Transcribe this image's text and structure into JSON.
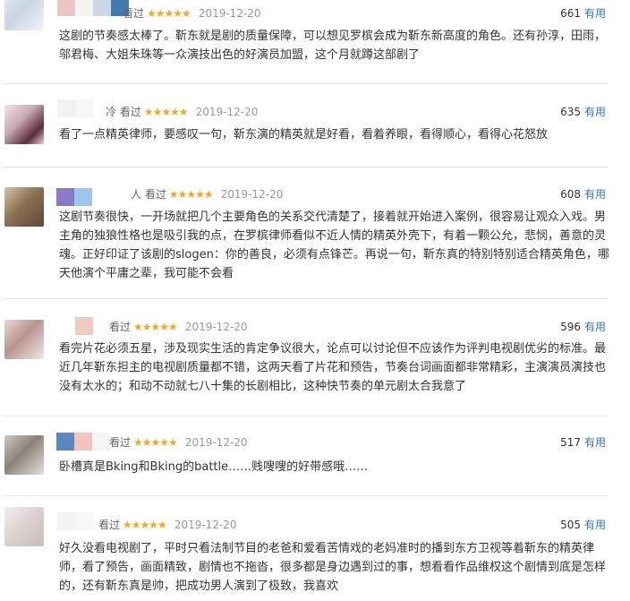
{
  "reviews": [
    {
      "watched_label": "看过",
      "stars": "★★★★★",
      "date": "2019-12-20",
      "votes": "661",
      "useful_label": "有用",
      "content": "这剧的节奏感太棒了。靳东就是剧的质量保障，可以想见罗槟会成为靳东新高度的角色。还有孙淳，田雨，邬君梅、大姐朱珠等一众演技出色的好演员加盟，这个月就蹲这部剧了"
    },
    {
      "watched_label": "冷 看过",
      "stars": "★★★★★",
      "date": "2019-12-20",
      "votes": "635",
      "useful_label": "有用",
      "content": "看了一点精英律师，要感叹一句，靳东演的精英就是好看，看着养眼，看得顺心，看得心花怒放"
    },
    {
      "watched_label": "人 看过",
      "stars": "★★★★★",
      "date": "2019-12-20",
      "votes": "608",
      "useful_label": "有用",
      "content": "这剧节奏很快，一开场就把几个主要角色的关系交代清楚了，接着就开始进入案例，很容易让观众入戏。男主角的独狼性格也是吸引我的点，在罗槟律师看似不近人情的精英外壳下，有着一颗公允，悲悯，善意的灵魂。正好印证了该剧的slogen：你的善良，必须有点锋芒。再说一句，靳东真的特别特别适合精英角色，哪天他演个平庸之辈，我可能不会看"
    },
    {
      "watched_label": "看过",
      "stars": "★★★★★",
      "date": "2019-12-20",
      "votes": "596",
      "useful_label": "有用",
      "content": "看完片花必须五星，涉及现实生活的肯定争议很大，论点可以讨论但不应该作为评判电视剧优劣的标准。最近几年靳东担主的电视剧质量都不错，这两天看了片花和预告，节奏台词画面都非常精彩，主演演员演技也没有太水的；和动不动就七八十集的长剧相比，这种快节奏的单元剧太合我意了"
    },
    {
      "watched_label": "看过",
      "stars": "★★★★★",
      "date": "2019-12-20",
      "votes": "517",
      "useful_label": "有用",
      "content": "卧槽真是Bking和Bking的battle……贱嗖嗖的好带感哦……"
    },
    {
      "watched_label": "看过",
      "stars": "★★★★★",
      "date": "2019-12-20",
      "votes": "505",
      "useful_label": "有用",
      "content": "好久没看电视剧了，平时只看法制节目的老爸和爱看苦情戏的老妈准时的播到东方卫视等着靳东的精英律师，看了预告，画面精致，剧情也不拖沓，很多都是身边遇到过的事，想看看作品维权这个剧情到底是怎样的，还有靳东真是帅，把成功男人演到了极致，我喜欢"
    }
  ]
}
